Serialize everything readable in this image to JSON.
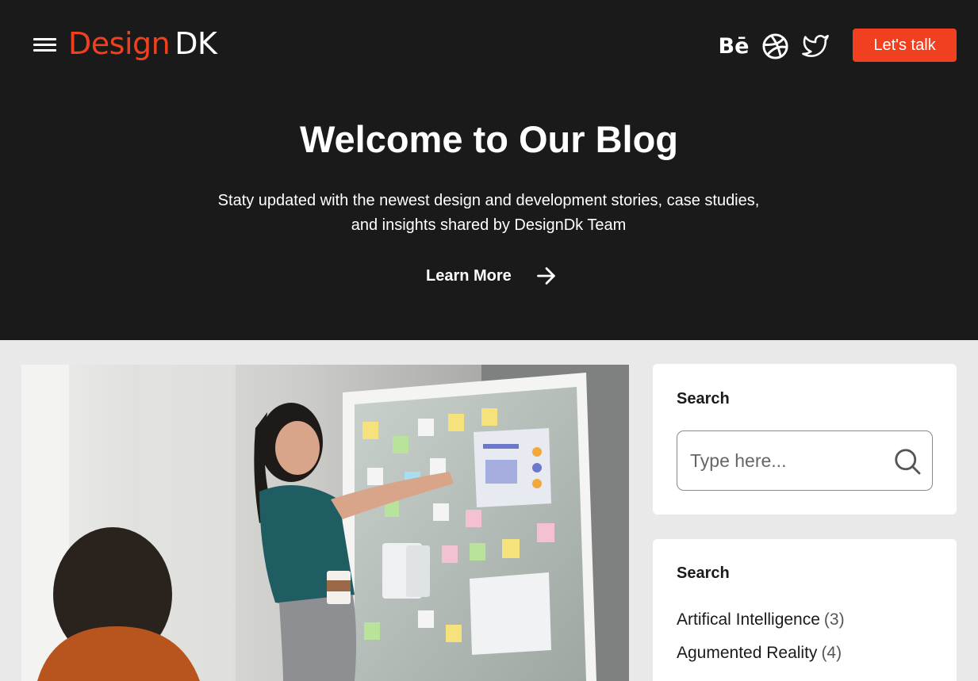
{
  "header": {
    "menu_icon": "hamburger-menu-icon",
    "logo": {
      "part1": "Design",
      "part2": "DK"
    },
    "social": [
      {
        "name": "Behance",
        "icon": "behance-icon",
        "glyph": "Bē"
      },
      {
        "name": "Dribbble",
        "icon": "dribbble-icon"
      },
      {
        "name": "Twitter",
        "icon": "twitter-icon"
      }
    ],
    "cta_label": "Let's talk"
  },
  "hero": {
    "title": "Welcome to Our Blog",
    "subtitle_line1": "Staty updated with the newest design and development stories, case studies,",
    "subtitle_line2": "and insights shared by DesignDk Team",
    "learn_more": "Learn More",
    "learn_more_icon": "arrow-right-icon"
  },
  "sidebar": {
    "search": {
      "title": "Search",
      "placeholder": "Type here...",
      "icon": "search-icon"
    },
    "categories": {
      "title": "Search",
      "items": [
        {
          "name": "Artifical Intelligence",
          "count": "(3)"
        },
        {
          "name": "Agumented Reality",
          "count": "(4)"
        }
      ]
    }
  },
  "colors": {
    "brand": "#f0401f",
    "hero_bg": "#1a1a1a",
    "page_bg": "#e9e9e9",
    "card_bg": "#ffffff"
  }
}
